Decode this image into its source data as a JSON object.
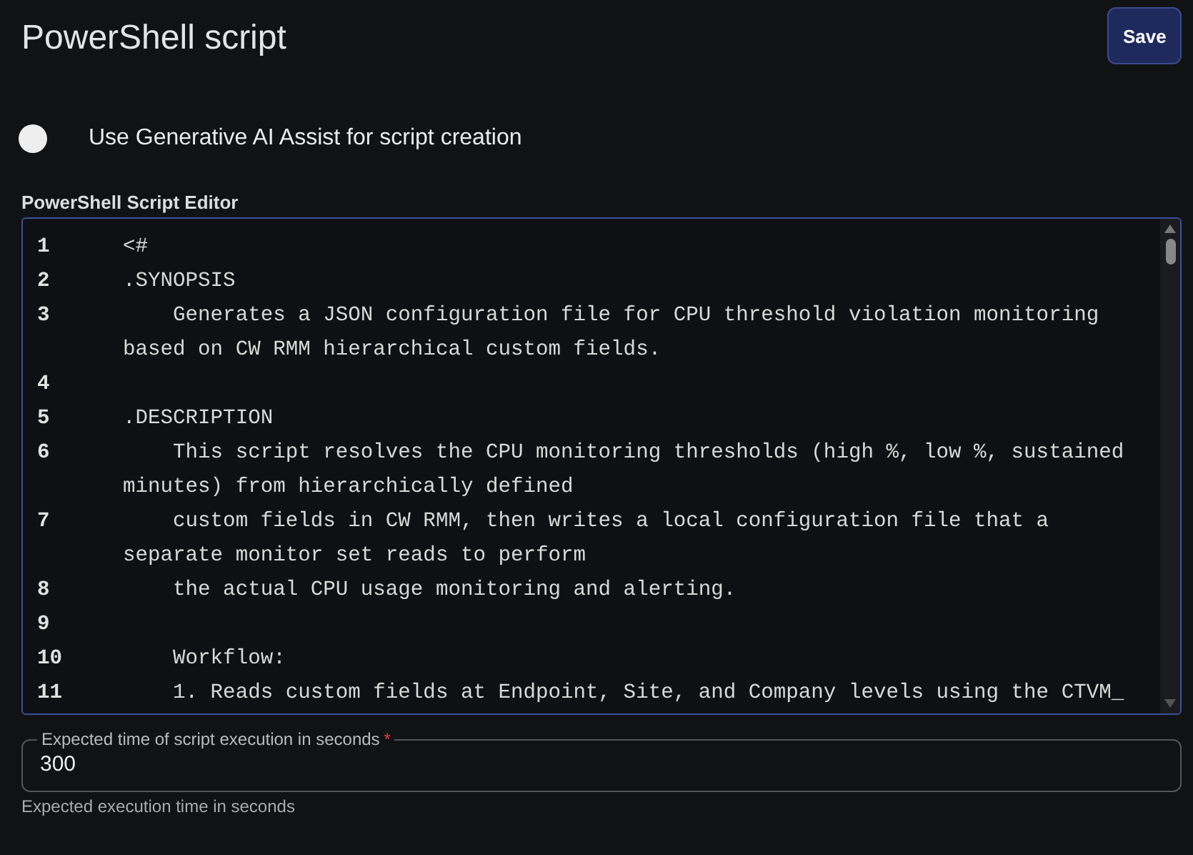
{
  "title": "PowerShell script",
  "save_button": "Save",
  "ai_toggle": {
    "label": "Use Generative AI Assist for script creation",
    "on": false
  },
  "editor": {
    "label": "PowerShell Script Editor",
    "lines": [
      {
        "number": "1",
        "text": "<#"
      },
      {
        "number": "2",
        "text": ".SYNOPSIS"
      },
      {
        "number": "3",
        "text": "    Generates a JSON configuration file for CPU threshold violation monitoring based on CW RMM hierarchical custom fields."
      },
      {
        "number": "4"
      },
      {
        "number": "5",
        "text": ".DESCRIPTION"
      },
      {
        "number": "6",
        "text": "    This script resolves the CPU monitoring thresholds (high %, low %, sustained minutes) from hierarchically defined"
      },
      {
        "number": "7",
        "text": "    custom fields in CW RMM, then writes a local configuration file that a separate monitor set reads to perform"
      },
      {
        "number": "8",
        "text": "    the actual CPU usage monitoring and alerting."
      },
      {
        "number": "9"
      },
      {
        "number": "10",
        "text": "    Workflow:"
      },
      {
        "number": "11",
        "text": "    1. Reads custom fields at Endpoint, Site, and Company levels using the CTVM_"
      }
    ]
  },
  "time_field": {
    "label": "Expected time of script execution in seconds",
    "required_mark": "*",
    "value": "300",
    "helper": "Expected execution time in seconds"
  }
}
